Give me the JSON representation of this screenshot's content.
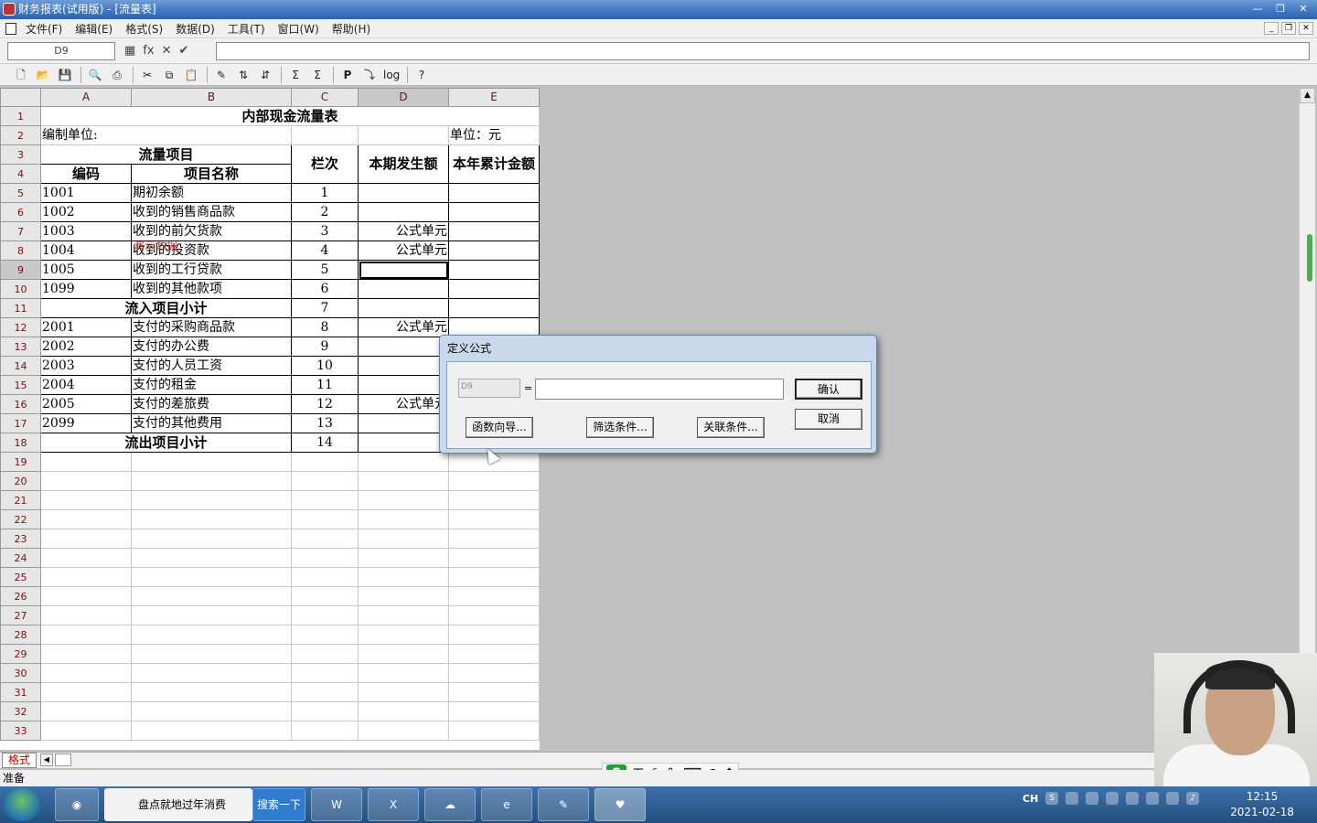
{
  "window": {
    "title": "财务报表(试用版) - [流量表]"
  },
  "menu": [
    "文件(F)",
    "编辑(E)",
    "格式(S)",
    "数据(D)",
    "工具(T)",
    "窗口(W)",
    "帮助(H)"
  ],
  "formula_bar": {
    "cell_ref": "D9",
    "fx": "fx",
    "cancel": "✕",
    "confirm": "✔"
  },
  "toolbar": [
    "new-icon",
    "open-icon",
    "save-icon",
    "preview-icon",
    "print-icon",
    "cut-icon",
    "copy-icon",
    "paste-icon",
    "format-brush-icon",
    "sort-asc-icon",
    "sort-desc-icon",
    "sum-icon",
    "sum-row-icon",
    "p-icon",
    "insert-icon",
    "log-icon",
    "help-icon"
  ],
  "sheet": {
    "columns": [
      "A",
      "B",
      "C",
      "D",
      "E"
    ],
    "row_numbers": [
      "1",
      "2",
      "3",
      "4",
      "5",
      "6",
      "7",
      "8",
      "9",
      "10",
      "11",
      "12",
      "13",
      "14",
      "15",
      "16",
      "17",
      "18",
      "19",
      "20",
      "21",
      "22",
      "23",
      "24",
      "25",
      "26",
      "27",
      "28",
      "29",
      "30",
      "31",
      "32",
      "33"
    ],
    "title": "内部现金流量表",
    "unit_left": "编制单位:",
    "unit_right": "单位：元",
    "headers": {
      "group": "流量项目",
      "code": "编码",
      "name": "项目名称",
      "col": "栏次",
      "current": "本期发生额",
      "ytd": "本年累计金额"
    },
    "rows": [
      {
        "code": "1001",
        "name": "期初余额",
        "col": "1",
        "d": ""
      },
      {
        "code": "1002",
        "name": "收到的销售商品款",
        "col": "2",
        "d": ""
      },
      {
        "code": "1003",
        "name": "收到的前欠货款",
        "col": "3",
        "d": "公式单元"
      },
      {
        "code": "1004",
        "name": "收到的投资款",
        "col": "4",
        "d": "公式单元"
      },
      {
        "code": "1005",
        "name": "收到的工行贷款",
        "col": "5",
        "d": ""
      },
      {
        "code": "1099",
        "name": "收到的其他款项",
        "col": "6",
        "d": ""
      },
      {
        "subtotal": "流入项目小计",
        "col": "7",
        "d": ""
      },
      {
        "code": "2001",
        "name": "支付的采购商品款",
        "col": "8",
        "d": "公式单元"
      },
      {
        "code": "2002",
        "name": "支付的办公费",
        "col": "9",
        "d": ""
      },
      {
        "code": "2003",
        "name": "支付的人员工资",
        "col": "10",
        "d": ""
      },
      {
        "code": "2004",
        "name": "支付的租金",
        "col": "11",
        "d": ""
      },
      {
        "code": "2005",
        "name": "支付的差旅费",
        "col": "12",
        "d": "公式单元"
      },
      {
        "code": "2099",
        "name": "支付的其他费用",
        "col": "13",
        "d": ""
      },
      {
        "subtotal": "流出项目小计",
        "col": "14",
        "d": ""
      }
    ],
    "overlay_text": "演示数据"
  },
  "sheet_tab": "格式",
  "status": "准备",
  "dialog": {
    "title": "定义公式",
    "cell_ref": "D9",
    "equals": "=",
    "formula_value": "",
    "ok": "确认",
    "cancel": "取消",
    "func_wizard": "函数向导...",
    "filter": "筛选条件...",
    "relation": "关联条件..."
  },
  "ime": {
    "mode": "五",
    "logo": "S"
  },
  "taskbar": {
    "ie_item": "盘点就地过年消费",
    "search": "搜索一下",
    "lang": "CH",
    "time": "12:15",
    "date": "2021-02-18"
  }
}
